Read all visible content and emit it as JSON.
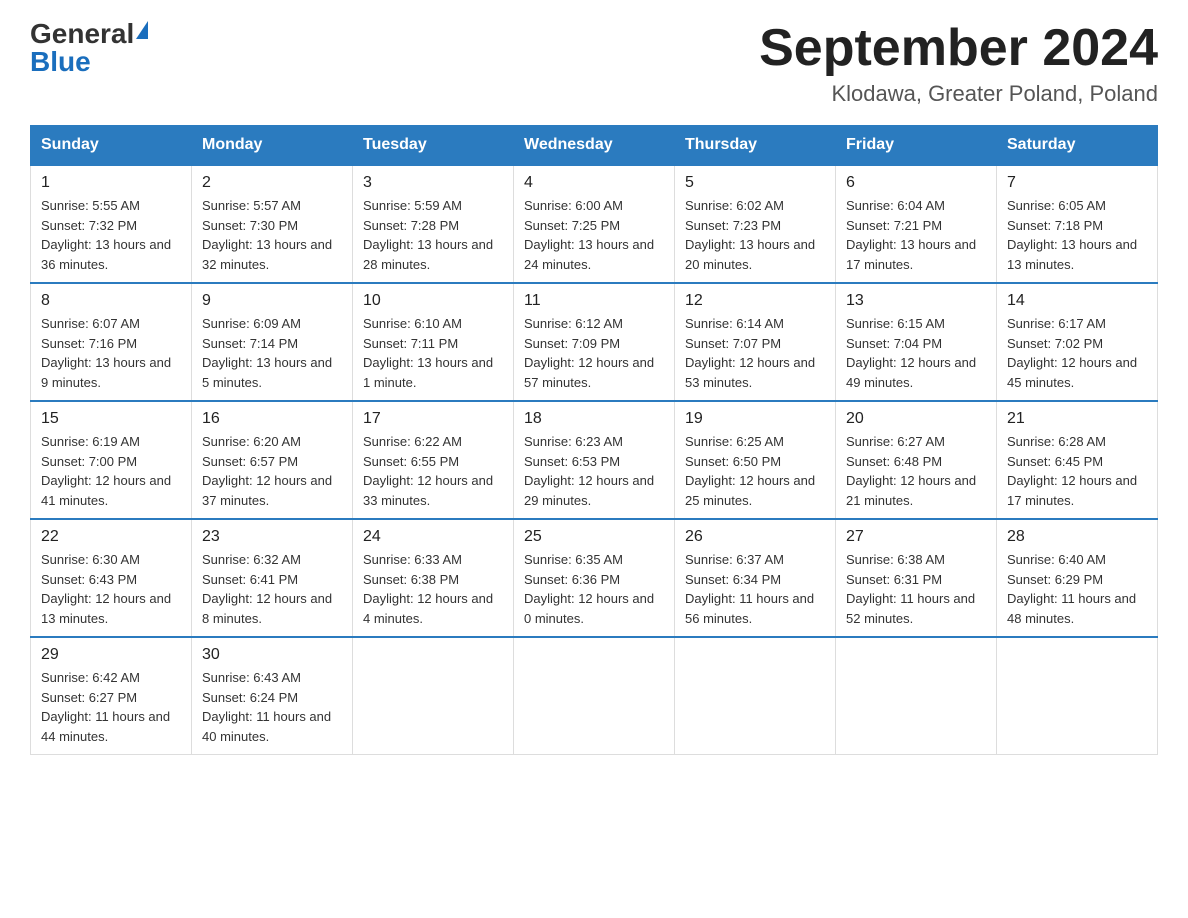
{
  "header": {
    "logo_general": "General",
    "logo_blue": "Blue",
    "title": "September 2024",
    "location": "Klodawa, Greater Poland, Poland"
  },
  "days_of_week": [
    "Sunday",
    "Monday",
    "Tuesday",
    "Wednesday",
    "Thursday",
    "Friday",
    "Saturday"
  ],
  "weeks": [
    [
      {
        "day": "1",
        "sunrise": "5:55 AM",
        "sunset": "7:32 PM",
        "daylight": "13 hours and 36 minutes."
      },
      {
        "day": "2",
        "sunrise": "5:57 AM",
        "sunset": "7:30 PM",
        "daylight": "13 hours and 32 minutes."
      },
      {
        "day": "3",
        "sunrise": "5:59 AM",
        "sunset": "7:28 PM",
        "daylight": "13 hours and 28 minutes."
      },
      {
        "day": "4",
        "sunrise": "6:00 AM",
        "sunset": "7:25 PM",
        "daylight": "13 hours and 24 minutes."
      },
      {
        "day": "5",
        "sunrise": "6:02 AM",
        "sunset": "7:23 PM",
        "daylight": "13 hours and 20 minutes."
      },
      {
        "day": "6",
        "sunrise": "6:04 AM",
        "sunset": "7:21 PM",
        "daylight": "13 hours and 17 minutes."
      },
      {
        "day": "7",
        "sunrise": "6:05 AM",
        "sunset": "7:18 PM",
        "daylight": "13 hours and 13 minutes."
      }
    ],
    [
      {
        "day": "8",
        "sunrise": "6:07 AM",
        "sunset": "7:16 PM",
        "daylight": "13 hours and 9 minutes."
      },
      {
        "day": "9",
        "sunrise": "6:09 AM",
        "sunset": "7:14 PM",
        "daylight": "13 hours and 5 minutes."
      },
      {
        "day": "10",
        "sunrise": "6:10 AM",
        "sunset": "7:11 PM",
        "daylight": "13 hours and 1 minute."
      },
      {
        "day": "11",
        "sunrise": "6:12 AM",
        "sunset": "7:09 PM",
        "daylight": "12 hours and 57 minutes."
      },
      {
        "day": "12",
        "sunrise": "6:14 AM",
        "sunset": "7:07 PM",
        "daylight": "12 hours and 53 minutes."
      },
      {
        "day": "13",
        "sunrise": "6:15 AM",
        "sunset": "7:04 PM",
        "daylight": "12 hours and 49 minutes."
      },
      {
        "day": "14",
        "sunrise": "6:17 AM",
        "sunset": "7:02 PM",
        "daylight": "12 hours and 45 minutes."
      }
    ],
    [
      {
        "day": "15",
        "sunrise": "6:19 AM",
        "sunset": "7:00 PM",
        "daylight": "12 hours and 41 minutes."
      },
      {
        "day": "16",
        "sunrise": "6:20 AM",
        "sunset": "6:57 PM",
        "daylight": "12 hours and 37 minutes."
      },
      {
        "day": "17",
        "sunrise": "6:22 AM",
        "sunset": "6:55 PM",
        "daylight": "12 hours and 33 minutes."
      },
      {
        "day": "18",
        "sunrise": "6:23 AM",
        "sunset": "6:53 PM",
        "daylight": "12 hours and 29 minutes."
      },
      {
        "day": "19",
        "sunrise": "6:25 AM",
        "sunset": "6:50 PM",
        "daylight": "12 hours and 25 minutes."
      },
      {
        "day": "20",
        "sunrise": "6:27 AM",
        "sunset": "6:48 PM",
        "daylight": "12 hours and 21 minutes."
      },
      {
        "day": "21",
        "sunrise": "6:28 AM",
        "sunset": "6:45 PM",
        "daylight": "12 hours and 17 minutes."
      }
    ],
    [
      {
        "day": "22",
        "sunrise": "6:30 AM",
        "sunset": "6:43 PM",
        "daylight": "12 hours and 13 minutes."
      },
      {
        "day": "23",
        "sunrise": "6:32 AM",
        "sunset": "6:41 PM",
        "daylight": "12 hours and 8 minutes."
      },
      {
        "day": "24",
        "sunrise": "6:33 AM",
        "sunset": "6:38 PM",
        "daylight": "12 hours and 4 minutes."
      },
      {
        "day": "25",
        "sunrise": "6:35 AM",
        "sunset": "6:36 PM",
        "daylight": "12 hours and 0 minutes."
      },
      {
        "day": "26",
        "sunrise": "6:37 AM",
        "sunset": "6:34 PM",
        "daylight": "11 hours and 56 minutes."
      },
      {
        "day": "27",
        "sunrise": "6:38 AM",
        "sunset": "6:31 PM",
        "daylight": "11 hours and 52 minutes."
      },
      {
        "day": "28",
        "sunrise": "6:40 AM",
        "sunset": "6:29 PM",
        "daylight": "11 hours and 48 minutes."
      }
    ],
    [
      {
        "day": "29",
        "sunrise": "6:42 AM",
        "sunset": "6:27 PM",
        "daylight": "11 hours and 44 minutes."
      },
      {
        "day": "30",
        "sunrise": "6:43 AM",
        "sunset": "6:24 PM",
        "daylight": "11 hours and 40 minutes."
      },
      null,
      null,
      null,
      null,
      null
    ]
  ]
}
